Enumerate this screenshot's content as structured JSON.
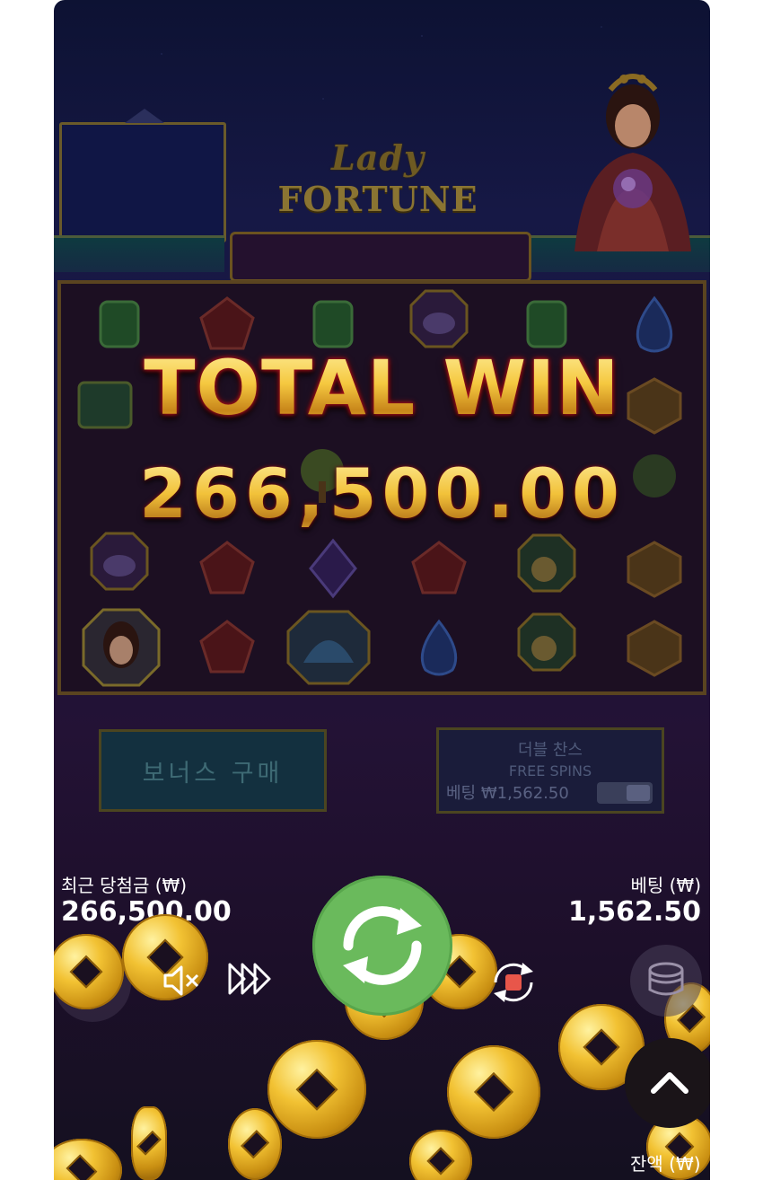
{
  "game": {
    "logo_line1": "Lady",
    "logo_line2": "FORTUNE"
  },
  "win": {
    "label": "TOTAL WIN",
    "amount": "266,500.00"
  },
  "buttons": {
    "bonus_buy": "보너스 구매",
    "double_chance_title": "더블 찬스",
    "double_chance_subtitle": "FREE SPINS",
    "double_chance_bet": "베팅 ₩1,562.50"
  },
  "stats": {
    "last_win_label": "최근 당첨금 (₩)",
    "last_win_value": "266,500.00",
    "bet_label": "베팅 (₩)",
    "bet_value": "1,562.50",
    "balance_label": "잔액 (₩)"
  },
  "colors": {
    "gold": "#f2c23a",
    "spin_green": "#6aba5c",
    "autoplay_red": "#e8564a"
  },
  "icons": {
    "spin": "refresh-icon",
    "mute": "speaker-muted-icon",
    "turbo": "fast-forward-icon",
    "autoplay": "autoplay-stop-icon",
    "balance": "coin-stack-icon",
    "scroll": "chevron-up-icon"
  }
}
